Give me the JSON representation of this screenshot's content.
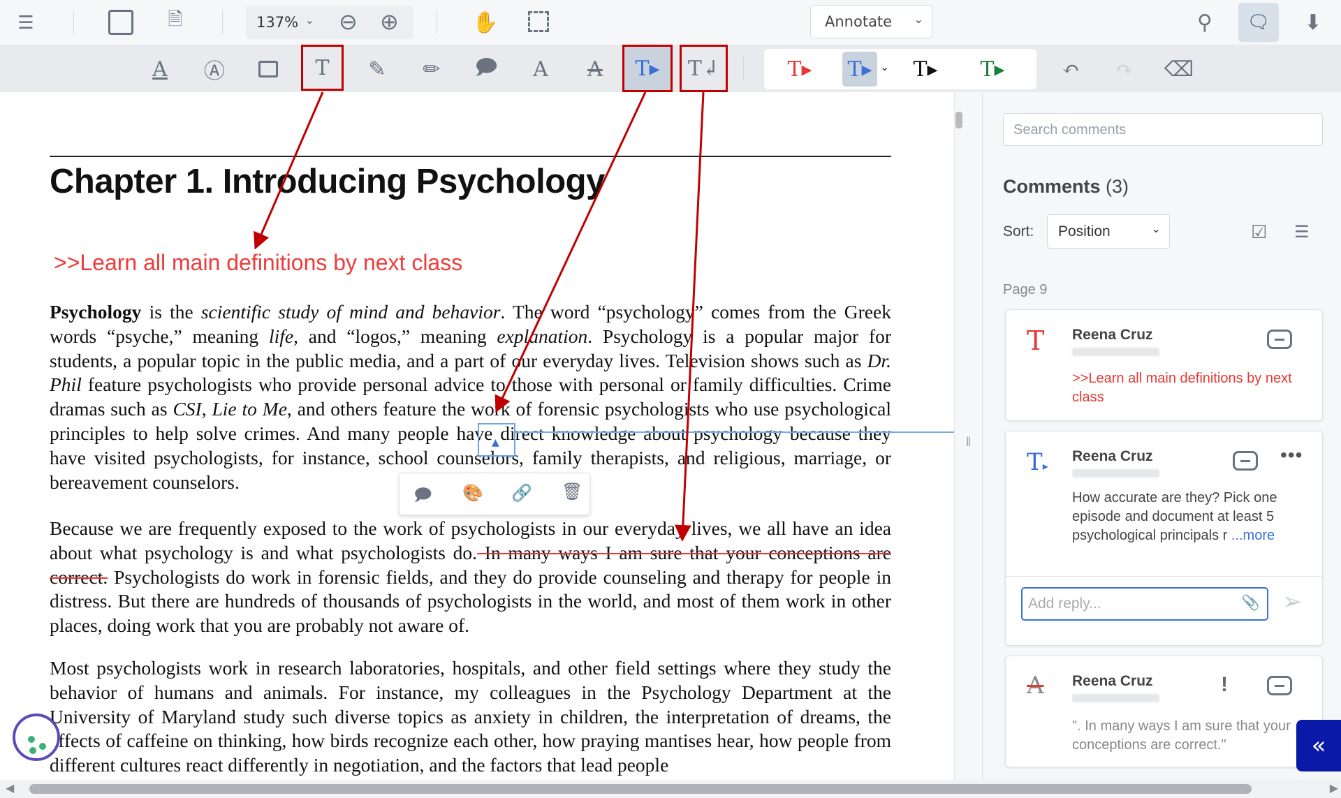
{
  "toolbar": {
    "zoom_value": "137%",
    "mode_select": "Annotate"
  },
  "document": {
    "heading": "Chapter 1. Introducing Psychology",
    "note": ">>Learn all main definitions by next class",
    "p1": [
      {
        "t": "Psychology",
        "s": "b"
      },
      {
        "t": " is the "
      },
      {
        "t": "scientific study of mind and behavior",
        "s": "i"
      },
      {
        "t": ". The word “psychology” comes from the Greek words “psyche,” meaning "
      },
      {
        "t": "life",
        "s": "i"
      },
      {
        "t": ", and “logos,” meaning "
      },
      {
        "t": "explanation",
        "s": "i"
      },
      {
        "t": ". Psychology is a popular major for students, a popular topic in the public media, and a part of our everyday lives. Television shows such as "
      },
      {
        "t": "Dr. Phil",
        "s": "i"
      },
      {
        "t": " feature psychologists who provide personal advice to those with personal or family difficulties. Crime dramas such as "
      },
      {
        "t": "CSI",
        "s": "i"
      },
      {
        "t": ", "
      },
      {
        "t": "Lie to Me",
        "s": "i"
      },
      {
        "t": ", and others feature the work of forensic psychologists who use psychological principles to help solve crimes. And many people have direct knowledge about psychology because they have visited psychologists, for instance, school counselors, family therapists, and religious, marriage, or bereavement counselors."
      }
    ],
    "p2_before": "Because we are frequently exposed to the work of psychologists in our everyday lives, we all have an idea about what psychology is and what psychologists do.",
    "p2_strike": " In many ways I am sure that your conceptions are correct.",
    "p2_after": " Psychologists do work in forensic fields, and they do provide counseling and therapy for people in distress. But there are hundreds of thousands of psychologists in the world, and most of them work in other places, doing work that you are probably not aware of.",
    "p3": "Most psychologists work in research laboratories, hospitals, and other field settings where they study the behavior of humans and animals. For instance, my colleagues in the Psychology Department at the University of Maryland study such diverse topics as anxiety in children, the interpretation of dreams, the effects of caffeine on thinking, how birds recognize each other, how praying mantises hear, how people from different cultures react differently in negotiation, and the factors that lead people"
  },
  "sidebar": {
    "search_placeholder": "Search comments",
    "title": "Comments",
    "count": "(3)",
    "sort_label": "Sort:",
    "sort_value": "Position",
    "page_label": "Page 9",
    "comments": [
      {
        "author": "Reena Cruz",
        "text": ">>Learn all main definitions by next class",
        "icon": "free-text-icon",
        "color": "#e53935"
      },
      {
        "author": "Reena Cruz",
        "text": "How accurate are they? Pick one episode and document at least 5 psychological principals r",
        "more": "...more",
        "icon": "insert-text-icon",
        "color": "#3b6fd8"
      },
      {
        "author": "Reena Cruz",
        "text": "\". In many ways I am sure that your conceptions are correct.\"",
        "icon": "strikeout-icon",
        "color": "#888888"
      }
    ],
    "reply_placeholder": "Add reply..."
  },
  "colors": {
    "accent": "#3b6fd8",
    "annotation_red": "#e53935",
    "highlight_box": "#c00000",
    "collapse_button": "#0a1aa8"
  }
}
